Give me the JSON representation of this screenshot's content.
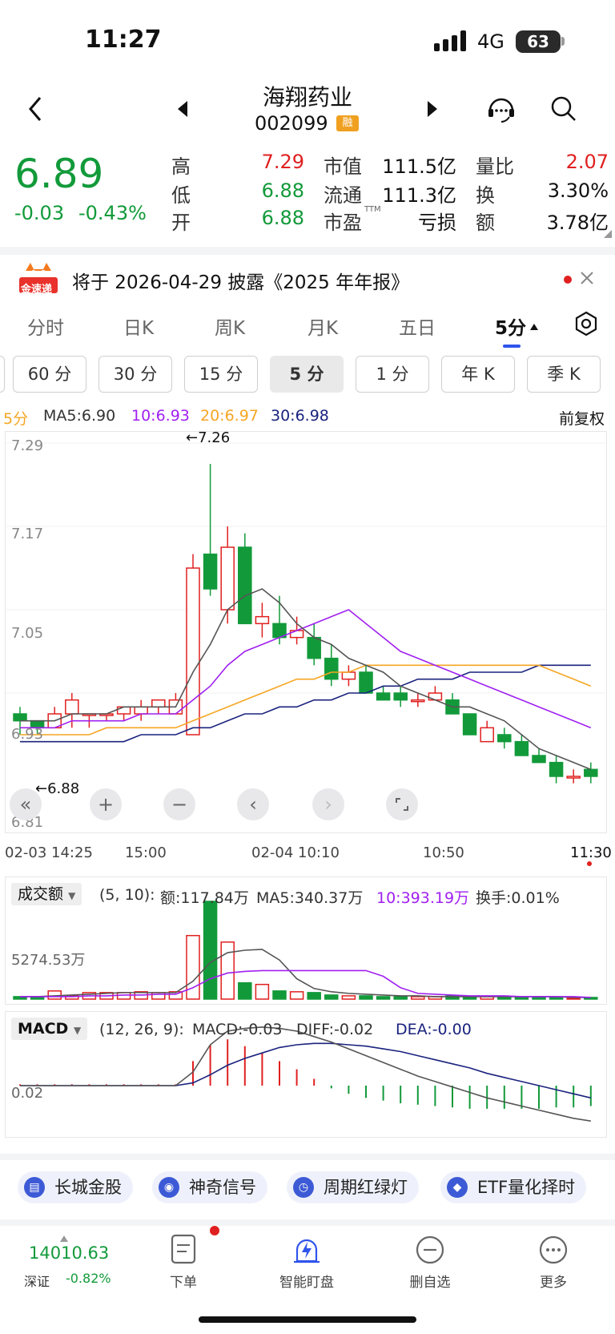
{
  "status": {
    "time": "11:27",
    "network": "4G",
    "battery": "63"
  },
  "header": {
    "title": "海翔药业",
    "code": "002099",
    "tag": "融"
  },
  "quote": {
    "price": "6.89",
    "change": "-0.03",
    "change_pct": "-0.43%",
    "high_label": "高",
    "high": "7.29",
    "low_label": "低",
    "low": "6.88",
    "open_label": "开",
    "open": "6.88",
    "mktcap_label": "市值",
    "mktcap": "111.5亿",
    "float_label": "流通",
    "float": "111.3亿",
    "pe_label": "市盈",
    "pe_sup": "TTM",
    "pe": "亏损",
    "vr_label": "量比",
    "vr": "2.07",
    "turnover_label": "换",
    "turnover": "3.30%",
    "amount_label": "额",
    "amount": "3.78亿"
  },
  "banner": {
    "logo": "金速递",
    "text": "将于 2026-04-29 披露《2025 年年报》"
  },
  "tabs": [
    "分时",
    "日K",
    "周K",
    "月K",
    "五日",
    "5分"
  ],
  "subtabs": [
    "60 分",
    "30 分",
    "15 分",
    "5 分",
    "1 分",
    "年 K",
    "季 K"
  ],
  "ma": {
    "period": "5分",
    "ma5": "MA5:6.90",
    "ma10": "10:6.93",
    "ma20": "20:6.97",
    "ma30": "30:6.98",
    "adjust": "前复权"
  },
  "price_axis": [
    "7.29",
    "7.17",
    "7.05",
    "6.93",
    "6.81"
  ],
  "annotations": {
    "high": "←7.26",
    "low": "←6.88"
  },
  "time_axis": [
    "02-03 14:25",
    "15:00",
    "02-04 10:10",
    "10:50",
    "11:30"
  ],
  "volume": {
    "label": "成交额",
    "params": "(5, 10):",
    "amount": "额:117.84万",
    "ma5": "MA5:340.37万",
    "ma10": "10:393.19万",
    "turnover": "换手:0.01%",
    "axis": "5274.53万"
  },
  "macd": {
    "label": "MACD",
    "params": "(12, 26, 9):",
    "macd": "MACD:-0.03",
    "diff": "DIFF:-0.02",
    "dea": "DEA:-0.00",
    "axis": "0.02"
  },
  "chips": [
    "长城金股",
    "神奇信号",
    "周期红绿灯",
    "ETF量化择时"
  ],
  "bottom": {
    "index_value": "14010.63",
    "index_name": "深证",
    "index_change": "-0.82%",
    "items": [
      "下单",
      "智能盯盘",
      "删自选",
      "更多"
    ]
  },
  "colors": {
    "up": "#e02020",
    "down": "#129a3a",
    "ma5": "#555555",
    "ma10": "#a020f0",
    "ma20": "#f5a623",
    "ma30": "#1a237e"
  },
  "chart_data": {
    "type": "candlestick",
    "candles": [
      [
        6.9,
        6.89,
        6.91,
        6.87
      ],
      [
        6.89,
        6.88,
        6.89,
        6.87
      ],
      [
        6.88,
        6.9,
        6.91,
        6.88
      ],
      [
        6.9,
        6.92,
        6.93,
        6.88
      ],
      [
        6.9,
        6.9,
        6.9,
        6.88
      ],
      [
        6.9,
        6.9,
        6.9,
        6.89
      ],
      [
        6.9,
        6.91,
        6.91,
        6.89
      ],
      [
        6.9,
        6.91,
        6.92,
        6.89
      ],
      [
        6.91,
        6.92,
        6.92,
        6.9
      ],
      [
        6.9,
        6.92,
        6.93,
        6.9
      ],
      [
        6.87,
        7.11,
        7.13,
        6.87
      ],
      [
        7.13,
        7.08,
        7.26,
        7.07
      ],
      [
        7.05,
        7.14,
        7.17,
        7.03
      ],
      [
        7.14,
        7.03,
        7.16,
        7.03
      ],
      [
        7.03,
        7.04,
        7.06,
        7.01
      ],
      [
        7.03,
        7.01,
        7.07,
        7.0
      ],
      [
        7.01,
        7.02,
        7.04,
        7.0
      ],
      [
        7.01,
        6.98,
        7.03,
        6.97
      ],
      [
        6.98,
        6.95,
        7.0,
        6.94
      ],
      [
        6.95,
        6.96,
        6.97,
        6.94
      ],
      [
        6.96,
        6.93,
        6.97,
        6.93
      ],
      [
        6.93,
        6.92,
        6.94,
        6.92
      ],
      [
        6.93,
        6.92,
        6.94,
        6.91
      ],
      [
        6.92,
        6.92,
        6.93,
        6.91
      ],
      [
        6.92,
        6.93,
        6.94,
        6.92
      ],
      [
        6.92,
        6.9,
        6.93,
        6.9
      ],
      [
        6.9,
        6.87,
        6.9,
        6.87
      ],
      [
        6.86,
        6.88,
        6.89,
        6.86
      ],
      [
        6.87,
        6.86,
        6.88,
        6.85
      ],
      [
        6.86,
        6.84,
        6.87,
        6.84
      ],
      [
        6.84,
        6.83,
        6.85,
        6.83
      ],
      [
        6.83,
        6.81,
        6.84,
        6.8
      ],
      [
        6.81,
        6.81,
        6.82,
        6.8
      ],
      [
        6.82,
        6.81,
        6.83,
        6.8
      ]
    ],
    "ma5": [
      6.89,
      6.89,
      6.89,
      6.9,
      6.9,
      6.9,
      6.91,
      6.91,
      6.91,
      6.91,
      6.96,
      7.0,
      7.05,
      7.07,
      7.08,
      7.06,
      7.03,
      7.01,
      7.0,
      6.98,
      6.97,
      6.96,
      6.94,
      6.93,
      6.92,
      6.91,
      6.91,
      6.9,
      6.89,
      6.87,
      6.85,
      6.84,
      6.83,
      6.82
    ],
    "ma10": [
      6.88,
      6.88,
      6.88,
      6.89,
      6.89,
      6.89,
      6.89,
      6.9,
      6.9,
      6.9,
      6.92,
      6.94,
      6.97,
      6.99,
      7.0,
      7.01,
      7.02,
      7.03,
      7.04,
      7.05,
      7.03,
      7.01,
      6.99,
      6.98,
      6.97,
      6.96,
      6.95,
      6.94,
      6.93,
      6.92,
      6.91,
      6.9,
      6.89,
      6.88
    ],
    "ma20": [
      6.87,
      6.87,
      6.87,
      6.87,
      6.87,
      6.88,
      6.88,
      6.88,
      6.88,
      6.88,
      6.89,
      6.9,
      6.91,
      6.92,
      6.93,
      6.94,
      6.95,
      6.95,
      6.96,
      6.96,
      6.97,
      6.97,
      6.97,
      6.97,
      6.97,
      6.97,
      6.97,
      6.97,
      6.97,
      6.97,
      6.97,
      6.96,
      6.95,
      6.94
    ],
    "ma30": [
      6.86,
      6.86,
      6.86,
      6.86,
      6.86,
      6.86,
      6.86,
      6.87,
      6.87,
      6.87,
      6.88,
      6.88,
      6.89,
      6.9,
      6.9,
      6.91,
      6.91,
      6.92,
      6.92,
      6.93,
      6.93,
      6.94,
      6.94,
      6.95,
      6.95,
      6.95,
      6.96,
      6.96,
      6.96,
      6.96,
      6.97,
      6.97,
      6.97,
      6.97
    ],
    "volume": [
      3,
      3,
      10,
      4,
      8,
      8,
      8,
      9,
      8,
      9,
      78,
      120,
      70,
      20,
      18,
      10,
      9,
      8,
      5,
      4,
      4,
      3,
      3,
      3,
      3,
      4,
      3,
      3,
      2,
      2,
      3,
      2,
      1,
      2
    ],
    "vol_ma5": [
      3,
      3,
      4,
      5,
      6,
      7,
      8,
      8,
      8,
      8,
      22,
      45,
      57,
      60,
      61,
      48,
      25,
      13,
      9,
      7,
      6,
      5,
      4,
      4,
      3,
      3,
      3,
      3,
      3,
      3,
      3,
      3,
      2,
      2
    ],
    "vol_ma10": [
      3,
      3,
      3,
      3,
      4,
      4,
      5,
      5,
      6,
      6,
      14,
      25,
      32,
      34,
      35,
      35,
      35,
      35,
      35,
      35,
      35,
      28,
      14,
      7,
      6,
      5,
      4,
      4,
      4,
      3,
      3,
      3,
      3,
      2
    ],
    "macd_hist": [
      0.001,
      0.001,
      0.001,
      0.001,
      0.001,
      0.001,
      0.001,
      0.001,
      0.001,
      0.001,
      0.018,
      0.03,
      0.034,
      0.029,
      0.024,
      0.018,
      0.012,
      0.005,
      -0.002,
      -0.006,
      -0.009,
      -0.011,
      -0.013,
      -0.014,
      -0.015,
      -0.016,
      -0.017,
      -0.017,
      -0.017,
      -0.017,
      -0.017,
      -0.016,
      -0.016,
      -0.015
    ],
    "dif": [
      0.0,
      0.0,
      0.0,
      0.0,
      0.0,
      0.0,
      0.0,
      0.0,
      0.0,
      0.0,
      0.01,
      0.03,
      0.04,
      0.042,
      0.043,
      0.042,
      0.04,
      0.036,
      0.032,
      0.027,
      0.022,
      0.017,
      0.012,
      0.007,
      0.003,
      -0.001,
      -0.005,
      -0.009,
      -0.012,
      -0.015,
      -0.018,
      -0.021,
      -0.024,
      -0.026
    ],
    "dea": [
      0.0,
      0.0,
      0.0,
      0.0,
      0.0,
      0.0,
      0.0,
      0.0,
      0.0,
      0.0,
      0.002,
      0.008,
      0.015,
      0.02,
      0.024,
      0.028,
      0.03,
      0.031,
      0.031,
      0.03,
      0.029,
      0.027,
      0.025,
      0.022,
      0.019,
      0.016,
      0.013,
      0.009,
      0.006,
      0.003,
      0.0,
      -0.003,
      -0.006,
      -0.009
    ],
    "ylim": [
      6.81,
      7.29
    ]
  }
}
